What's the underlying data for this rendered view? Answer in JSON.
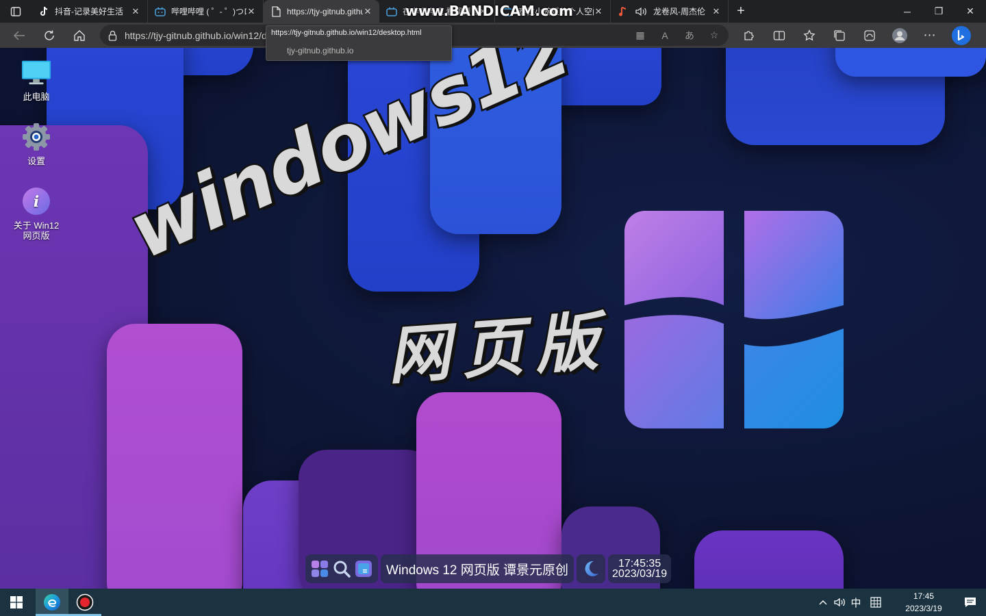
{
  "browser": {
    "tabs": [
      {
        "title": "抖音-记录美好生活",
        "icon": "tiktok-icon"
      },
      {
        "title": "哔哩哔哩 ( ゜- ゜)つロ",
        "icon": "bilibili-icon"
      },
      {
        "title": "https://tjy-gitnub.github.io/win12/desktop.html",
        "icon": "page-icon",
        "active": true
      },
      {
        "title": "在哔哩哔哩 看视频 点赞 投币 收藏",
        "icon": "bilibili-icon"
      },
      {
        "title": "泰拉小豌豆的个人空间",
        "icon": "bilibili-icon"
      },
      {
        "title": "龙卷风-周杰伦",
        "icon": "music-icon"
      }
    ],
    "url": "https://tjy-gitnub.github.io/win12/desktop.html",
    "url_tooltip": {
      "full": "https://tjy-gitnub.github.io/win12/desktop.html",
      "host": "tjy-gitnub.github.io"
    }
  },
  "watermark": "www.BANDICAM.com",
  "desktop": {
    "icons": [
      {
        "label": "此电脑",
        "icon": "this-pc-icon"
      },
      {
        "label": "设置",
        "icon": "settings-icon"
      },
      {
        "label": "关于 Win12 网页版",
        "icon": "about-icon"
      }
    ],
    "title_line1": "windows12",
    "title_line2": "网页版",
    "web_taskbar": {
      "label": "Windows 12 网页版 谭景元原创",
      "time": "17:45:35",
      "date": "2023/03/19"
    }
  },
  "taskbar": {
    "ime": "中",
    "time": "17:45",
    "date": "2023/3/19"
  },
  "colors": {
    "desktop_bg": "#0d1533",
    "tab_strip": "#202124",
    "toolbar": "#3b3b3d",
    "taskbar": "#1b3340"
  }
}
